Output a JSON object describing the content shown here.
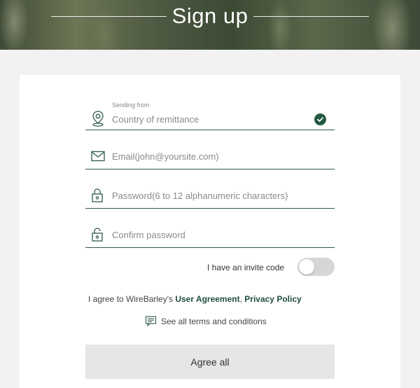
{
  "header": {
    "title": "Sign up"
  },
  "form": {
    "country": {
      "label": "Sending from",
      "placeholder": "Country of remittance"
    },
    "email": {
      "placeholder": "Email(john@yoursite.com)"
    },
    "password": {
      "placeholder": "Password(6 to 12 alphanumeric characters)"
    },
    "confirm": {
      "placeholder": "Confirm password"
    },
    "invite": {
      "label": "I have an invite code"
    },
    "agreement": {
      "prefix": "I agree to WireBarley's ",
      "user_agreement": "User Agreement",
      "separator": ", ",
      "privacy_policy": "Privacy Policy"
    },
    "terms_link": "See all terms and conditions",
    "agree_all_button": "Agree all"
  },
  "colors": {
    "accent": "#235a42",
    "underline": "#2f5a48",
    "button_bg": "#e6e6e6"
  },
  "icons": [
    "location-pin-icon",
    "check-circle-icon",
    "envelope-icon",
    "lock-icon",
    "unlock-icon",
    "document-icon"
  ]
}
